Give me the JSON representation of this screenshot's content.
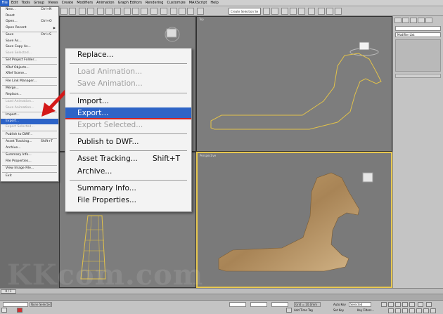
{
  "menubar": {
    "items": [
      "File",
      "Edit",
      "Tools",
      "Group",
      "Views",
      "Create",
      "Modifiers",
      "Animation",
      "Graph Editors",
      "Rendering",
      "Customize",
      "MAXScript",
      "Help"
    ],
    "active_index": 0
  },
  "toolbar": {
    "selection_set_placeholder": "Create Selection Se"
  },
  "viewports": {
    "top_label": "Top",
    "perspective_label": "Perspective"
  },
  "command_panel": {
    "modifier_list_label": "Modifier List"
  },
  "file_menu": {
    "items": [
      {
        "label": "New...",
        "shortcut": "Ctrl+N",
        "disabled": false
      },
      {
        "label": "Reset",
        "shortcut": "",
        "disabled": false
      },
      {
        "label": "Open...",
        "shortcut": "Ctrl+O",
        "disabled": false
      },
      {
        "label": "Open Recent",
        "shortcut": "",
        "disabled": false,
        "submenu": true
      },
      {
        "sep": true
      },
      {
        "label": "Save",
        "shortcut": "Ctrl+S",
        "disabled": false
      },
      {
        "label": "Save As...",
        "shortcut": "",
        "disabled": false
      },
      {
        "label": "Save Copy As...",
        "shortcut": "",
        "disabled": false
      },
      {
        "label": "Save Selected...",
        "shortcut": "",
        "disabled": true
      },
      {
        "sep": true
      },
      {
        "label": "Set Project Folder...",
        "shortcut": "",
        "disabled": false
      },
      {
        "sep": true
      },
      {
        "label": "XRef Objects...",
        "shortcut": "",
        "disabled": false
      },
      {
        "label": "XRef Scene...",
        "shortcut": "",
        "disabled": false
      },
      {
        "sep": true
      },
      {
        "label": "File Link Manager...",
        "shortcut": "",
        "disabled": false
      },
      {
        "sep": true
      },
      {
        "label": "Merge...",
        "shortcut": "",
        "disabled": false
      },
      {
        "label": "Replace...",
        "shortcut": "",
        "disabled": false
      },
      {
        "sep": true
      },
      {
        "label": "Load Animation...",
        "shortcut": "",
        "disabled": true
      },
      {
        "label": "Save Animation...",
        "shortcut": "",
        "disabled": true
      },
      {
        "sep": true
      },
      {
        "label": "Import...",
        "shortcut": "",
        "disabled": false
      },
      {
        "label": "Export...",
        "shortcut": "",
        "disabled": false,
        "highlighted": true
      },
      {
        "label": "Export Selected...",
        "shortcut": "",
        "disabled": true
      },
      {
        "sep": true
      },
      {
        "label": "Publish to DWF...",
        "shortcut": "",
        "disabled": false
      },
      {
        "sep": true
      },
      {
        "label": "Asset Tracking...",
        "shortcut": "Shift+T",
        "disabled": false
      },
      {
        "label": "Archive...",
        "shortcut": "",
        "disabled": false
      },
      {
        "sep": true
      },
      {
        "label": "Summary Info...",
        "shortcut": "",
        "disabled": false
      },
      {
        "label": "File Properties...",
        "shortcut": "",
        "disabled": false
      },
      {
        "sep": true
      },
      {
        "label": "View Image File...",
        "shortcut": "",
        "disabled": false
      },
      {
        "sep": true
      },
      {
        "label": "Exit",
        "shortcut": "",
        "disabled": false
      }
    ]
  },
  "zoom_menu": {
    "items": [
      {
        "label": "Replace...",
        "shortcut": "",
        "disabled": false
      },
      {
        "sep": true
      },
      {
        "label": "Load Animation...",
        "shortcut": "",
        "disabled": true
      },
      {
        "label": "Save Animation...",
        "shortcut": "",
        "disabled": true
      },
      {
        "sep": true
      },
      {
        "label": "Import...",
        "shortcut": "",
        "disabled": false
      },
      {
        "label": "Export...",
        "shortcut": "",
        "disabled": false,
        "highlighted": true
      },
      {
        "label": "Export Selected...",
        "shortcut": "",
        "disabled": true
      },
      {
        "sep": true
      },
      {
        "label": "Publish to DWF...",
        "shortcut": "",
        "disabled": false
      },
      {
        "sep": true
      },
      {
        "label": "Asset Tracking...",
        "shortcut": "Shift+T",
        "disabled": false
      },
      {
        "label": "Archive...",
        "shortcut": "",
        "disabled": false
      },
      {
        "sep": true
      },
      {
        "label": "Summary Info...",
        "shortcut": "",
        "disabled": false
      },
      {
        "label": "File Properties...",
        "shortcut": "",
        "disabled": false
      }
    ]
  },
  "timeline": {
    "frame_label": "0 / 1"
  },
  "status_bar": {
    "selected_text": "None Selected",
    "grid_text": "Grid = 10.0mm",
    "add_time_tag": "Add Time Tag",
    "auto_key": "Auto Key",
    "set_key": "Set Key",
    "selected_dropdown": "Selected",
    "key_filters": "Key Filters..."
  },
  "colors": {
    "highlight": "#2e64c6",
    "arrow": "#d41818",
    "viewport_active_border": "#e8c850"
  },
  "watermark": "KKcom.com"
}
